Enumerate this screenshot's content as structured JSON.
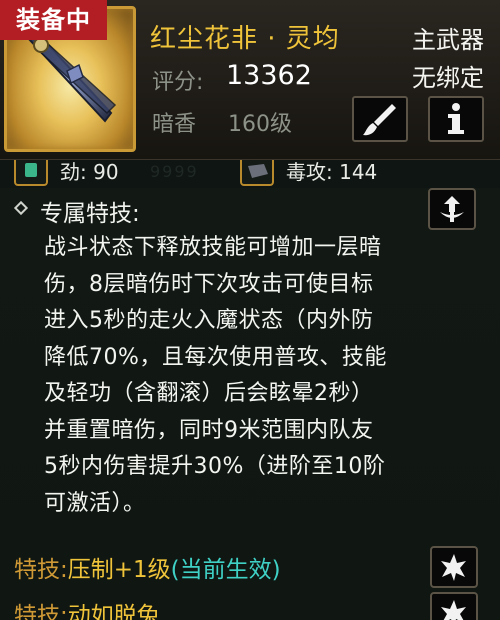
{
  "header": {
    "equipped_badge": "装备中",
    "item_name": "红尘花非 · 灵均",
    "weapon_type": "主武器",
    "bind_state": "无绑定",
    "score_label": "评分:",
    "score_value": "13362",
    "sub_label": "暗香",
    "sub_value": "160级"
  },
  "stats": {
    "stat1": "劲: 90",
    "stat2": "毒攻: 144",
    "ghost": "9999"
  },
  "special": {
    "title": "专属特技:",
    "description_lines": [
      "战斗状态下释放技能可增加一层暗",
      "伤，8层暗伤时下次攻击可使目标",
      "进入5秒的走火入魔状态（内外防",
      "降低70%，且每次使用普攻、技能",
      "及轻功（含翻滚）后会眩晕2秒）",
      "并重置暗伤，同时9米范围内队友",
      "5秒内伤害提升30%（进阶至10阶",
      "可激活）。"
    ]
  },
  "skills": [
    {
      "label": "特技:",
      "name": "压制",
      "level": "+1级",
      "status": "(当前生效)"
    },
    {
      "label": "特技:",
      "name": "动如脱兔",
      "level": "",
      "status": ""
    }
  ],
  "colors": {
    "badge_red": "#b21e23",
    "gold": "#f0c43a",
    "teal": "#3fd1c6",
    "frame_gold": "#c99a36"
  },
  "icons": {
    "brush": "brush-icon",
    "info": "info-icon",
    "skill_tree": "skill-tree-icon",
    "star": "star-burst-icon"
  }
}
